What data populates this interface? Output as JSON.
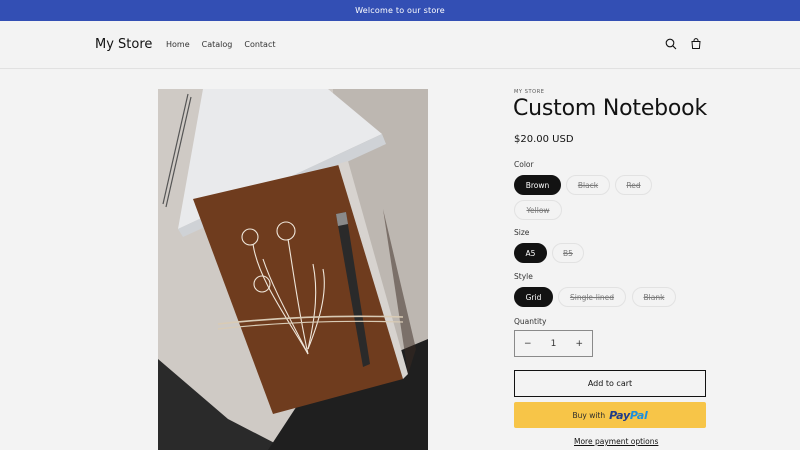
{
  "announcement": {
    "text": "Welcome to our store"
  },
  "header": {
    "logo": "My Store",
    "nav": [
      "Home",
      "Catalog",
      "Contact"
    ],
    "icons": {
      "search": "search-icon",
      "cart": "cart-icon"
    }
  },
  "product": {
    "vendor": "MY STORE",
    "title": "Custom Notebook",
    "price": "$20.00 USD",
    "image_alt": "notebook-photo"
  },
  "options": {
    "color": {
      "label": "Color",
      "values": [
        "Brown",
        "Black",
        "Red",
        "Yellow"
      ],
      "selected": "Brown"
    },
    "size": {
      "label": "Size",
      "values": [
        "A5",
        "B5"
      ],
      "selected": "A5"
    },
    "style": {
      "label": "Style",
      "values": [
        "Grid",
        "Single-lined",
        "Blank"
      ],
      "selected": "Grid"
    }
  },
  "quantity": {
    "label": "Quantity",
    "value": "1",
    "minus": "−",
    "plus": "+"
  },
  "buttons": {
    "add_to_cart": "Add to cart",
    "paypal_prefix": "Buy with",
    "paypal_pay": "Pay",
    "paypal_pal": "Pal",
    "more_options": "More payment options"
  },
  "colors": {
    "announcement_bg": "#334fb4",
    "paypal_bg": "#f7c548",
    "active_pill": "#121212"
  }
}
